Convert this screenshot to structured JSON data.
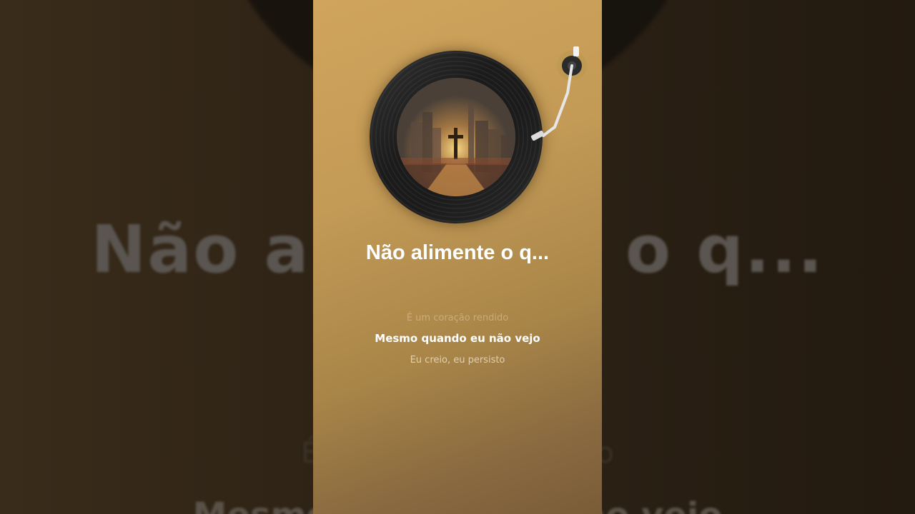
{
  "song": {
    "title": "Não alimente o q..."
  },
  "lyrics": {
    "previous": "É um coração rendido",
    "current": "Mesmo quando eu não vejo",
    "next": "Eu creio, eu persisto"
  },
  "background": {
    "title": "Não alimente o q...",
    "line1": "É um coração rendido",
    "line2": "Mesmo quando eu não vejo"
  },
  "icons": {
    "record": "vinyl-record-icon",
    "tonearm": "tonearm-icon",
    "artwork": "album-art-cross-city"
  },
  "colors": {
    "panel_top": "#d0a45c",
    "panel_bottom": "#7a5c38",
    "backdrop": "#2a2014",
    "title_text": "#ffffff"
  }
}
